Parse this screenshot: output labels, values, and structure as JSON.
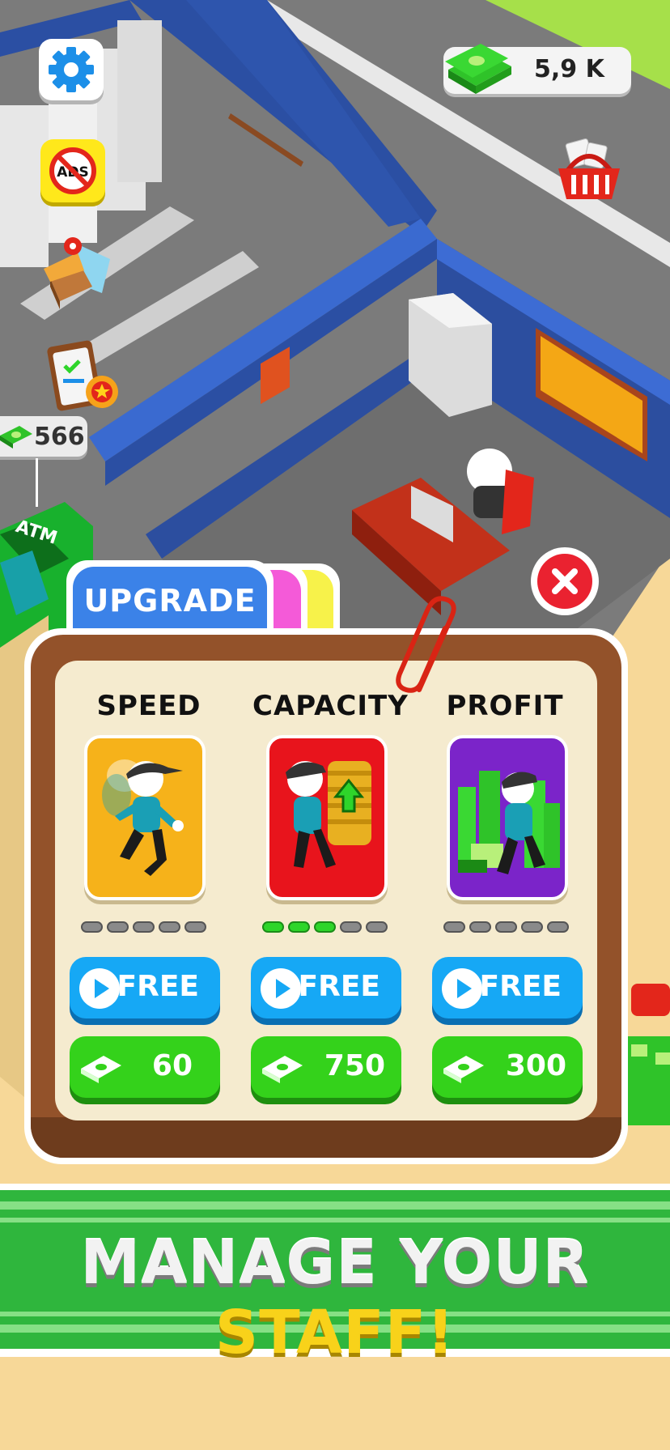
{
  "hud": {
    "money": "5,9 K",
    "buttons": [
      "gear-icon",
      "no-ads-icon",
      "pizza-map-icon",
      "task-list-icon",
      "shop-basket-icon"
    ]
  },
  "world": {
    "atm_price": "566",
    "atm_label": "ATM",
    "atm_screen_label": "ATM"
  },
  "panel": {
    "tab_label": "UPGRADE",
    "columns": [
      {
        "title": "SPEED",
        "level": 0,
        "max_level": 5,
        "free_label": "FREE",
        "price": "60",
        "card_color": "#f6b21a"
      },
      {
        "title": "CAPACITY",
        "level": 3,
        "max_level": 5,
        "free_label": "FREE",
        "price": "750",
        "card_color": "#e8141c"
      },
      {
        "title": "PROFIT",
        "level": 0,
        "max_level": 5,
        "free_label": "FREE",
        "price": "300",
        "card_color": "#7b24c9"
      }
    ]
  },
  "banner": {
    "word1": "MANAGE",
    "word2": "YOUR",
    "word3": "STAFF!"
  },
  "colors": {
    "free_button": "#16a8f5",
    "cash_button": "#34d21b",
    "level_on": "#2ed52a",
    "level_off": "#8a8a8a",
    "panel_brown": "#93522a",
    "wall_blue": "#2b4fa3"
  }
}
